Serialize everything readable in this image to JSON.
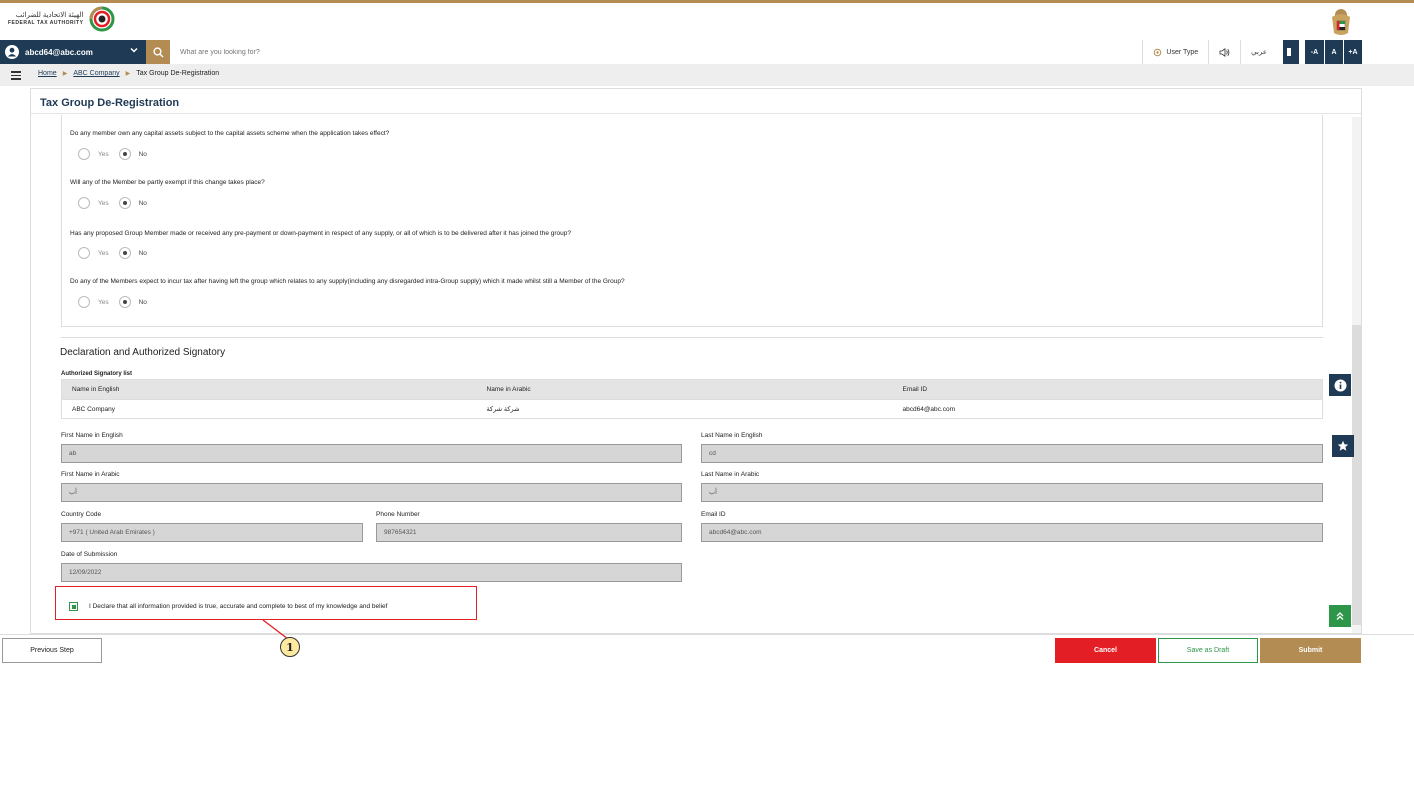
{
  "header": {
    "logo_ar": "الهيئة الاتحادية للضرائب",
    "logo_en": "FEDERAL TAX AUTHORITY",
    "brand_color": "#b28c53",
    "navy": "#1e3a55"
  },
  "navbar": {
    "user_email": "abcd64@abc.com",
    "search_placeholder": "What are you looking for?",
    "user_type_label": "User Type",
    "arabic_label": "عربي",
    "font_minus": "-A",
    "font_normal": "A",
    "font_plus": "+A"
  },
  "breadcrumb": {
    "home": "Home",
    "company": "ABC Company",
    "current": "Tax Group De-Registration"
  },
  "page": {
    "title": "Tax Group De-Registration"
  },
  "questions": [
    {
      "text": "Do any member own any capital assets subject to the capital assets scheme when the application takes effect?",
      "yes": "Yes",
      "no": "No",
      "selected": "No"
    },
    {
      "text": "Will any of the Member be partly exempt if this change takes place?",
      "yes": "Yes",
      "no": "No",
      "selected": "No"
    },
    {
      "text": "Has any proposed Group Member made or received any pre-payment or down-payment in respect of any supply, or all of which is to be delivered after it has joined the group?",
      "yes": "Yes",
      "no": "No",
      "selected": "No"
    },
    {
      "text": "Do any of the Members expect to incur tax after having left the group which relates to any supply(including any disregarded intra-Group supply) which it made whilst still a Member of the Group?",
      "yes": "Yes",
      "no": "No",
      "selected": "No"
    }
  ],
  "declaration": {
    "section_title": "Declaration and Authorized Signatory",
    "list_label": "Authorized Signatory list",
    "table_headers": [
      "Name in English",
      "Name in Arabic",
      "Email ID"
    ],
    "table_row": [
      "ABC Company",
      "شركة شركة",
      "abcd64@abc.com"
    ],
    "first_name_en_label": "First Name in English",
    "first_name_en": "ab",
    "last_name_en_label": "Last Name in English",
    "last_name_en": "cd",
    "first_name_ar_label": "First Name in Arabic",
    "first_name_ar": "أب",
    "last_name_ar_label": "Last Name in Arabic",
    "last_name_ar": "أب",
    "country_code_label": "Country Code",
    "country_code": "+971 ( United Arab Emirates )",
    "phone_label": "Phone Number",
    "phone": "987654321",
    "email_label": "Email ID",
    "email": "abcd64@abc.com",
    "date_label": "Date of Submission",
    "date": "12/09/2022",
    "declare_text": "I Declare that all information provided is true, accurate and complete to best of my knowledge and belief",
    "declare_checked": true
  },
  "annotation": {
    "number": "1"
  },
  "footer": {
    "previous": "Previous Step",
    "cancel": "Cancel",
    "draft": "Save as Draft",
    "submit": "Submit"
  }
}
